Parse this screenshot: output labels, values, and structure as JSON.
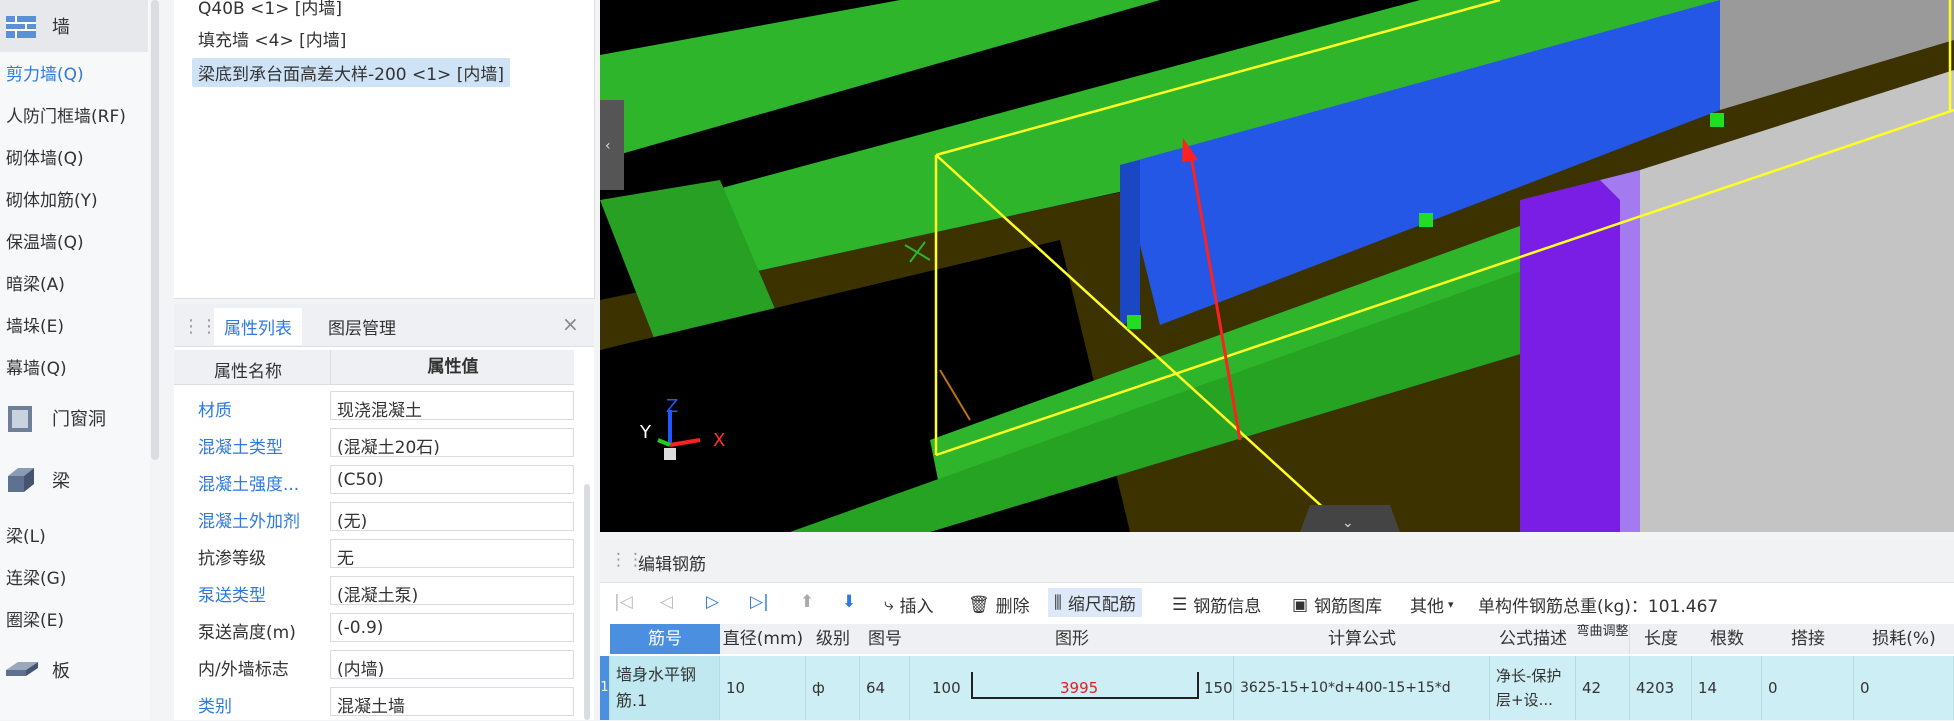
{
  "nav": {
    "categories": [
      {
        "label": "墙",
        "icon": "wall-icon"
      },
      {
        "label": "门窗洞",
        "icon": "door-window-icon"
      },
      {
        "label": "梁",
        "icon": "beam-icon"
      },
      {
        "label": "板",
        "icon": "slab-icon"
      }
    ],
    "wall_items": [
      "剪力墙(Q)",
      "人防门框墙(RF)",
      "砌体墙(Q)",
      "砌体加筋(Y)",
      "保温墙(Q)",
      "暗梁(A)",
      "墙垛(E)",
      "幕墙(Q)"
    ],
    "beam_items": [
      "梁(L)",
      "连梁(G)",
      "圈梁(E)"
    ]
  },
  "component_list": {
    "items": [
      "Q40B <1> [内墙]",
      "填充墙 <4> [内墙]",
      "梁底到承台面高差大样-200 <1> [内墙]"
    ]
  },
  "properties": {
    "tab_active": "属性列表",
    "tab_other": "图层管理",
    "col_name": "属性名称",
    "col_value": "属性值",
    "rows": [
      {
        "name": "材质",
        "value": "现浇混凝土"
      },
      {
        "name": "混凝土类型",
        "value": "(混凝土20石)"
      },
      {
        "name": "混凝土强度...",
        "value": "(C50)"
      },
      {
        "name": "混凝土外加剂",
        "value": "(无)"
      },
      {
        "name": "抗渗等级",
        "value": "无"
      },
      {
        "name": "泵送类型",
        "value": "(混凝土泵)"
      },
      {
        "name": "泵送高度(m)",
        "value": "(-0.9)"
      },
      {
        "name": "内/外墙标志",
        "value": "(内墙)"
      },
      {
        "name": "类别",
        "value": "混凝土墙"
      }
    ]
  },
  "viewport": {
    "axis_x": "X",
    "axis_y": "Y",
    "axis_z": "Z",
    "colors": {
      "beam": "#2fb52c",
      "wall": "#2557e6",
      "selection": "#ffff22",
      "column": "#7a1ee6",
      "gray": "#b8b8b8"
    }
  },
  "rebar_editor": {
    "title": "编辑钢筋",
    "toolbar": {
      "insert": "插入",
      "delete": "删除",
      "scale": "缩尺配筋",
      "info": "钢筋信息",
      "library": "钢筋图库",
      "other": "其他",
      "total_label": "单构件钢筋总重(kg)：101.467"
    },
    "columns": [
      "筋号",
      "直径(mm)",
      "级别",
      "图号",
      "图形",
      "计算公式",
      "公式描述",
      "弯曲调整",
      "长度",
      "根数",
      "搭接",
      "损耗(%)"
    ],
    "row": {
      "index": "1",
      "name": "墙身水平钢筋.1",
      "diameter": "10",
      "grade": "ф",
      "figure_no": "64",
      "shape_left": "100",
      "shape_mid": "3995",
      "shape_right": "150",
      "formula": "3625-15+10*d+400-15+15*d",
      "description": "净长-保护层+设...",
      "bend": "42",
      "length": "4203",
      "count": "14",
      "lap": "0",
      "loss": "0"
    }
  }
}
